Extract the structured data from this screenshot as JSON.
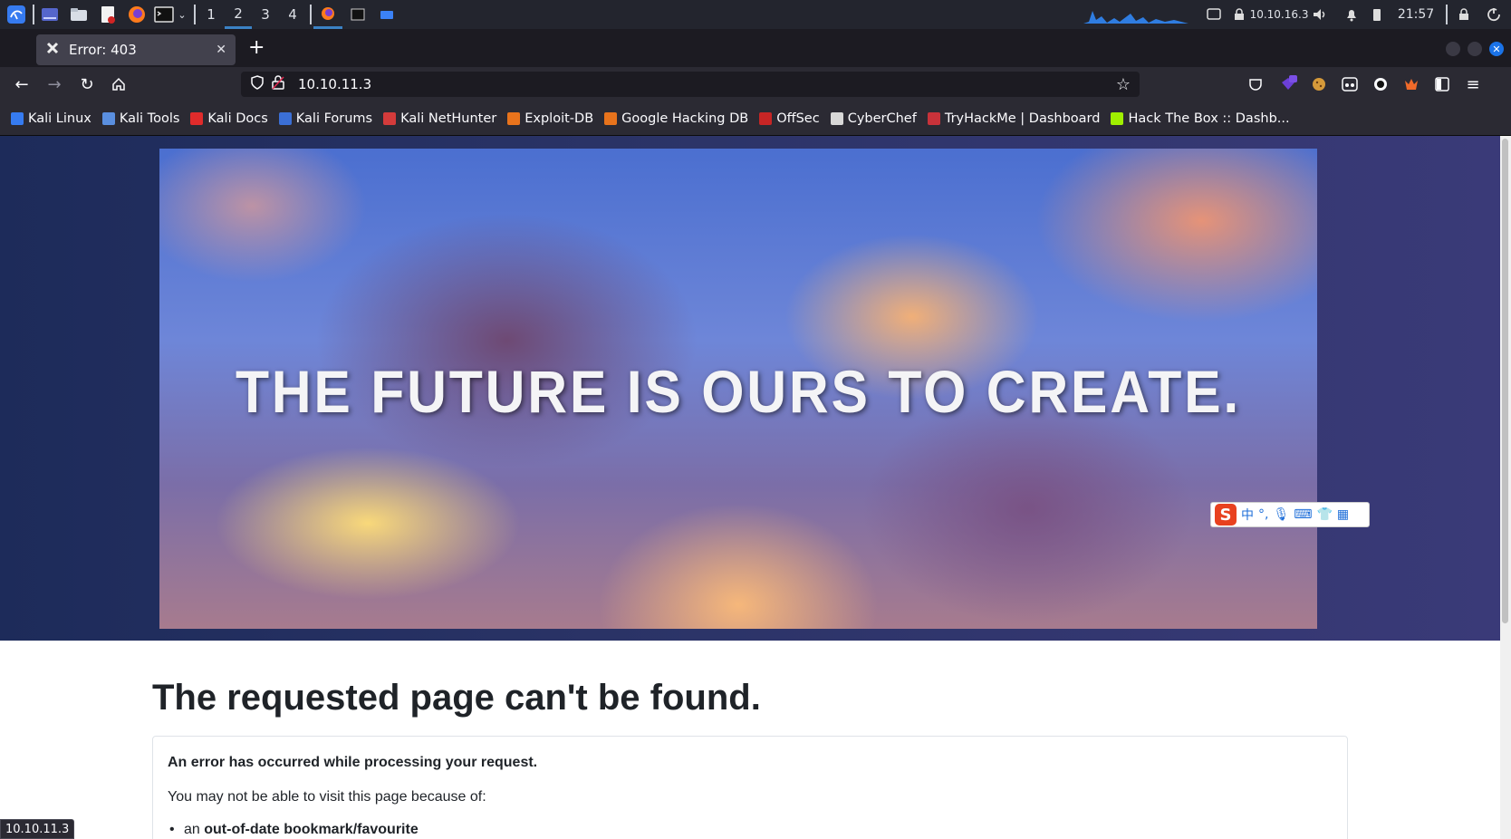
{
  "panel": {
    "workspaces": [
      "1",
      "2",
      "3",
      "4"
    ],
    "active_workspace": "2",
    "vpn_ip": "10.10.16.3",
    "clock": "21:57"
  },
  "browser": {
    "tab_title": "Error: 403",
    "url": "10.10.11.3",
    "bookmarks": [
      {
        "label": "Kali Linux",
        "color": "#367bf0"
      },
      {
        "label": "Kali Tools",
        "color": "#5a8fe0"
      },
      {
        "label": "Kali Docs",
        "color": "#e02b2b"
      },
      {
        "label": "Kali Forums",
        "color": "#3b6fd6"
      },
      {
        "label": "Kali NetHunter",
        "color": "#d43b3b"
      },
      {
        "label": "Exploit-DB",
        "color": "#e8731c"
      },
      {
        "label": "Google Hacking DB",
        "color": "#e8731c"
      },
      {
        "label": "OffSec",
        "color": "#c72525"
      },
      {
        "label": "CyberChef",
        "color": "#d8d8d8"
      },
      {
        "label": "TryHackMe | Dashboard",
        "color": "#c8323a"
      },
      {
        "label": "Hack The Box :: Dashb...",
        "color": "#9fef00"
      }
    ],
    "status_url": "10.10.11.3"
  },
  "page": {
    "hero_text": "THE FUTURE IS OURS TO CREATE.",
    "error_title": "The requested page can't be found.",
    "error_strong": "An error has occurred while processing your request.",
    "error_body": "You may not be able to visit this page because of:",
    "error_item_prefix": "an ",
    "error_item_strong": "out-of-date bookmark/favourite"
  },
  "ime": {
    "mode": "中"
  }
}
